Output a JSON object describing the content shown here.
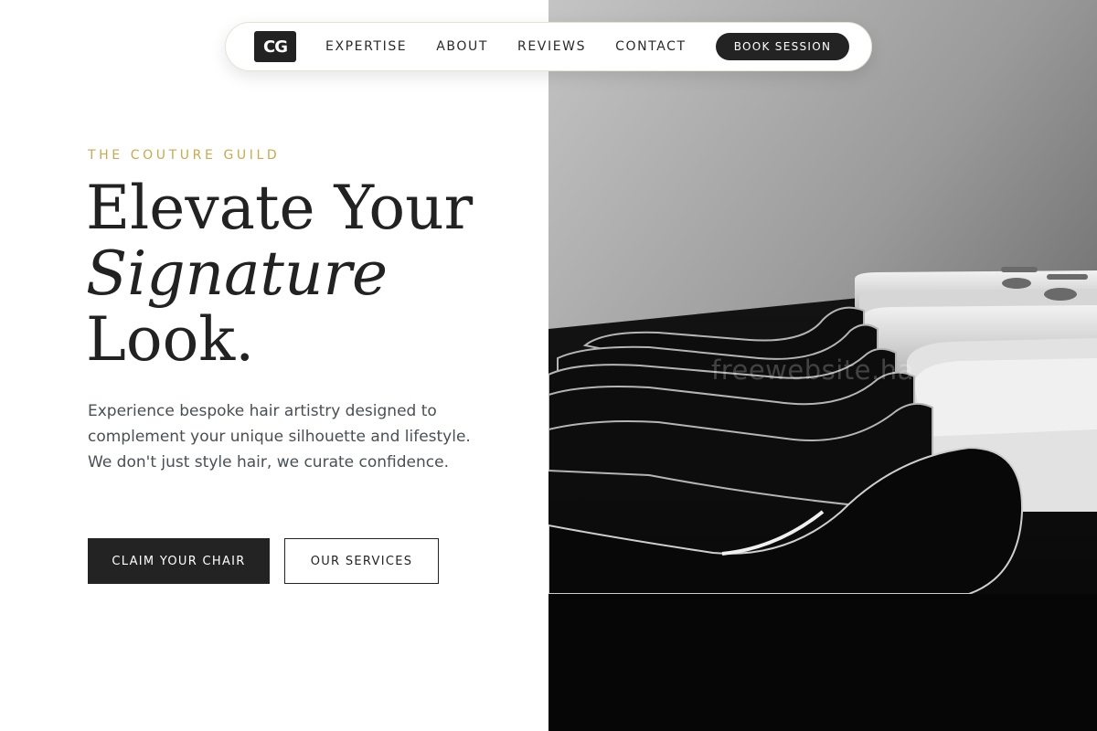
{
  "nav": {
    "logo_text": "CG",
    "links": [
      "EXPERTISE",
      "ABOUT",
      "REVIEWS",
      "CONTACT"
    ],
    "cta_label": "BOOK SESSION"
  },
  "hero": {
    "eyebrow": "THE COUTURE GUILD",
    "headline": {
      "line1": "Elevate Your",
      "line2": "Signature",
      "line3": "Look."
    },
    "lede": "Experience bespoke hair artistry designed to complement your unique silhouette and lifestyle. We don't just style hair, we curate confidence.",
    "primary_cta": "CLAIM YOUR CHAIR",
    "secondary_cta": "OUR SERVICES"
  },
  "photo": {
    "subject": "salon-wash-chairs-photo",
    "watermark": "freewebsite.ha"
  },
  "colors": {
    "accent_gold": "#c9a84e",
    "dark": "#232323",
    "body_text": "#4a4f55"
  }
}
